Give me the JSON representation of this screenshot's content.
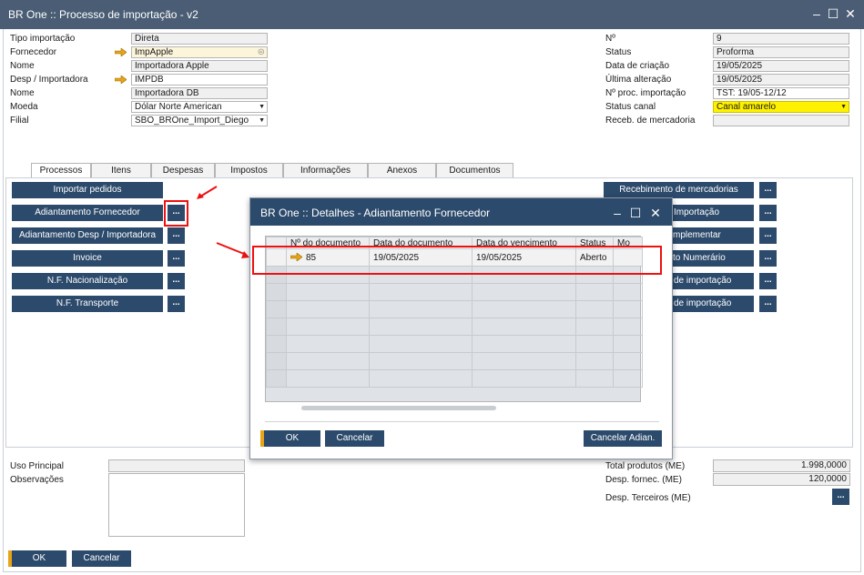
{
  "window": {
    "title": "BR One :: Processo de importação - v2"
  },
  "header_left": {
    "tipo_importacao": {
      "label": "Tipo importação",
      "value": "Direta"
    },
    "fornecedor": {
      "label": "Fornecedor",
      "value": "ImpApple"
    },
    "nome1": {
      "label": "Nome",
      "value": "Importadora Apple"
    },
    "desp_importadora": {
      "label": "Desp / Importadora",
      "value": "IMPDB"
    },
    "nome2": {
      "label": "Nome",
      "value": "Importadora DB"
    },
    "moeda": {
      "label": "Moeda",
      "value": "Dólar Norte American"
    },
    "filial": {
      "label": "Filial",
      "value": "SBO_BROne_Import_Diego"
    }
  },
  "header_right": {
    "numero": {
      "label": "Nº",
      "value": "9"
    },
    "status": {
      "label": "Status",
      "value": "Proforma"
    },
    "data_criacao": {
      "label": "Data de criação",
      "value": "19/05/2025"
    },
    "ultima_alteracao": {
      "label": "Última alteração",
      "value": "19/05/2025"
    },
    "proc_importacao": {
      "label": "Nº proc. importação",
      "value": "TST: 19/05-12/12"
    },
    "status_canal": {
      "label": "Status canal",
      "value": "Canal amarelo"
    },
    "receb_mercadoria": {
      "label": "Receb. de mercadoria",
      "value": ""
    }
  },
  "tabs": [
    "Processos",
    "Itens",
    "Despesas",
    "Impostos",
    "Informações",
    "Anexos",
    "Documentos"
  ],
  "left_buttons": [
    "Importar pedidos",
    "Adiantamento Fornecedor",
    "Adiantamento Desp / Importadora",
    "Invoice",
    "N.F. Nacionalização",
    "N.F. Transporte"
  ],
  "right_buttons": [
    "Recebimento de mercadorias",
    "Importação",
    "mplementar",
    "to Numerário",
    "de importação",
    "de importação"
  ],
  "ellipsis": "...",
  "bottom_left": {
    "uso_principal": "Uso Principal",
    "observacoes": "Observações"
  },
  "bottom_right": {
    "total_produtos": {
      "label": "Total produtos (ME)",
      "value": "1.998,0000"
    },
    "desp_fornec": {
      "label": "Desp. fornec. (ME)",
      "value": "120,0000"
    },
    "desp_terceiros": {
      "label": "Desp. Terceiros (ME)"
    }
  },
  "footer": {
    "ok": "OK",
    "cancelar": "Cancelar"
  },
  "modal": {
    "title": "BR One :: Detalhes - Adiantamento Fornecedor",
    "columns": [
      "Nº do documento",
      "Data do documento",
      "Data do vencimento",
      "Status",
      "Mo"
    ],
    "rows": [
      {
        "numero": "85",
        "data_documento": "19/05/2025",
        "data_vencimento": "19/05/2025",
        "status": "Aberto",
        "moeda": ""
      }
    ],
    "ok": "OK",
    "cancelar": "Cancelar",
    "cancelar_adian": "Cancelar Adian."
  },
  "colors": {
    "titlebar": "#4a5d74",
    "button": "#2c4a6b",
    "canal_amarelo": "#fff200",
    "accent": "#e8a317",
    "annotation": "#e11111"
  }
}
